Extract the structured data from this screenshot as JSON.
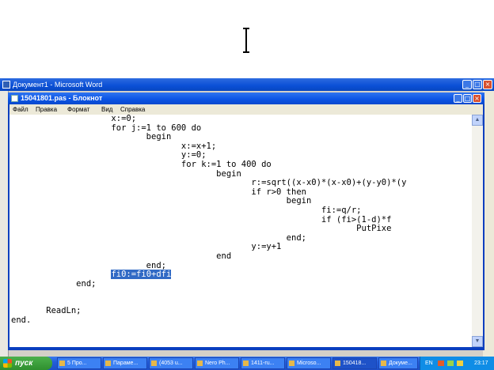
{
  "word_window": {
    "title": "Документ1 - Microsoft Word"
  },
  "notepad": {
    "title": "15041801.pas - Блокнот",
    "menu": [
      "Файл",
      "Правка",
      "Формат",
      "Вид",
      "Справка"
    ]
  },
  "code_lines": [
    "                    x:=0;",
    "                    for j:=1 to 600 do",
    "                           begin",
    "                                  x:=x+1;",
    "                                  y:=0;",
    "                                  for k:=1 to 400 do",
    "                                         begin",
    "                                                r:=sqrt((x-x0)*(x-x0)+(y-y0)*(y",
    "                                                if r>0 then",
    "                                                       begin",
    "                                                              fi:=q/r;",
    "                                                              if (fi>(1-d)*f",
    "                                                                     PutPixe",
    "                                                       end;",
    "                                                y:=y+1",
    "                                         end",
    "                           end;",
    "                    ",
    "             end;",
    "",
    "",
    "       ReadLn;",
    "end."
  ],
  "selected_line": {
    "indent": "                    ",
    "text": "fi0:=fi0+dfi"
  },
  "taskbar": {
    "start_label": "пуск",
    "tasks": [
      "5 Про...",
      "Параме...",
      "(4053 u...",
      "Nero Ph...",
      "1411-ru...",
      "Microso...",
      "150418...",
      "Докуме..."
    ],
    "active_task": 6,
    "tray_lang": "EN",
    "clock": "23:17"
  }
}
